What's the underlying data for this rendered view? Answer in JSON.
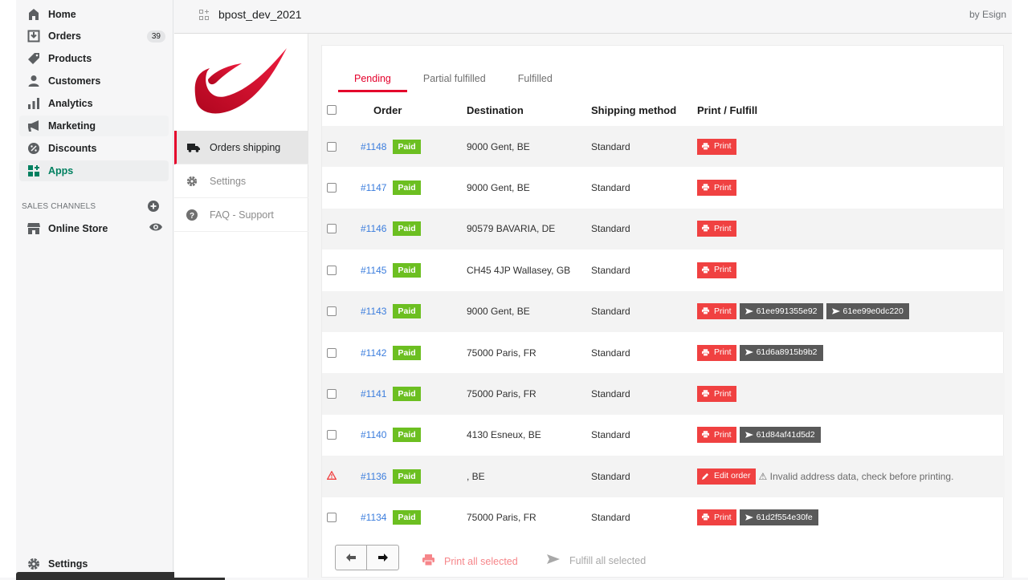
{
  "nav": {
    "items": [
      {
        "label": "Home",
        "icon": "home-icon"
      },
      {
        "label": "Orders",
        "icon": "orders-icon",
        "badge": "39"
      },
      {
        "label": "Products",
        "icon": "tag-icon"
      },
      {
        "label": "Customers",
        "icon": "person-icon"
      },
      {
        "label": "Analytics",
        "icon": "bar-chart-icon"
      },
      {
        "label": "Marketing",
        "icon": "megaphone-icon"
      },
      {
        "label": "Discounts",
        "icon": "discount-icon"
      },
      {
        "label": "Apps",
        "icon": "apps-icon",
        "active": true
      }
    ],
    "sales_channels_title": "SALES CHANNELS",
    "online_store": "Online Store",
    "settings": "Settings"
  },
  "topbar": {
    "app_title": "bpost_dev_2021",
    "by": "by Esign"
  },
  "app_sidebar": {
    "links": [
      {
        "label": "Orders shipping",
        "icon": "truck-icon",
        "active": true
      },
      {
        "label": "Settings",
        "icon": "gear-icon"
      },
      {
        "label": "FAQ - Support",
        "icon": "help-icon"
      }
    ]
  },
  "tabs": [
    "Pending",
    "Partial fulfilled",
    "Fulfilled"
  ],
  "table": {
    "headers": {
      "order": "Order",
      "destination": "Destination",
      "shipping": "Shipping method",
      "print": "Print / Fulfill"
    },
    "rows": [
      {
        "order": "#1148",
        "status": "Paid",
        "destination": "9000 Gent, BE",
        "shipping": "Standard",
        "print": "Print",
        "tracking": []
      },
      {
        "order": "#1147",
        "status": "Paid",
        "destination": "9000 Gent, BE",
        "shipping": "Standard",
        "print": "Print",
        "tracking": []
      },
      {
        "order": "#1146",
        "status": "Paid",
        "destination": "90579 BAVARIA, DE",
        "shipping": "Standard",
        "print": "Print",
        "tracking": []
      },
      {
        "order": "#1145",
        "status": "Paid",
        "destination": "CH45 4JP Wallasey, GB",
        "shipping": "Standard",
        "print": "Print",
        "tracking": []
      },
      {
        "order": "#1143",
        "status": "Paid",
        "destination": "9000 Gent, BE",
        "shipping": "Standard",
        "print": "Print",
        "tracking": [
          "61ee991355e92",
          "61ee99e0dc220"
        ]
      },
      {
        "order": "#1142",
        "status": "Paid",
        "destination": "75000 Paris, FR",
        "shipping": "Standard",
        "print": "Print",
        "tracking": [
          "61d6a8915b9b2"
        ]
      },
      {
        "order": "#1141",
        "status": "Paid",
        "destination": "75000 Paris, FR",
        "shipping": "Standard",
        "print": "Print",
        "tracking": []
      },
      {
        "order": "#1140",
        "status": "Paid",
        "destination": "4130 Esneux, BE",
        "shipping": "Standard",
        "print": "Print",
        "tracking": [
          "61d84af41d5d2"
        ]
      },
      {
        "order": "#1136",
        "status": "Paid",
        "destination": ", BE",
        "shipping": "Standard",
        "warning": true,
        "edit": "Edit order",
        "warning_text": "⚠ Invalid address data, check before printing.",
        "tracking": []
      },
      {
        "order": "#1134",
        "status": "Paid",
        "destination": "75000 Paris, FR",
        "shipping": "Standard",
        "print": "Print",
        "tracking": [
          "61d2f554e30fe"
        ]
      }
    ]
  },
  "footer": {
    "print_all": "Print all selected",
    "fulfill_all": "Fulfill all selected"
  },
  "colors": {
    "accent": "#e4002b",
    "paid": "#6cbf21",
    "print": "#f04141",
    "tracking": "#595959",
    "link": "#3b7ddd",
    "apps_active": "#008060"
  }
}
